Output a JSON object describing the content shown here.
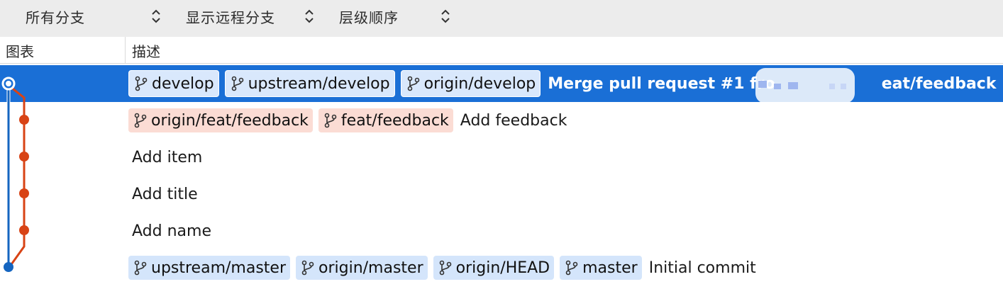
{
  "toolbar": {
    "branch_filter": "所有分支",
    "remote_filter": "显示远程分支",
    "order_filter": "层级顺序"
  },
  "columns": {
    "graph": "图表",
    "description": "描述"
  },
  "colors": {
    "selection": "#1a6fd6",
    "main_line": "#1565c0",
    "branch_line": "#d84315",
    "local_tag": "#d4e5fb",
    "remote_tag": "#fbdcd4"
  },
  "commits": [
    {
      "refs": [
        "develop",
        "upstream/develop",
        "origin/develop"
      ],
      "message": "Merge pull request #1 fro",
      "message_tail": "eat/feedback",
      "selected": true
    },
    {
      "refs": [
        "origin/feat/feedback",
        "feat/feedback"
      ],
      "message": "Add feedback"
    },
    {
      "refs": [],
      "message": "Add item"
    },
    {
      "refs": [],
      "message": "Add title"
    },
    {
      "refs": [],
      "message": "Add name"
    },
    {
      "refs": [
        "upstream/master",
        "origin/master",
        "origin/HEAD",
        "master"
      ],
      "message": "Initial commit"
    }
  ]
}
